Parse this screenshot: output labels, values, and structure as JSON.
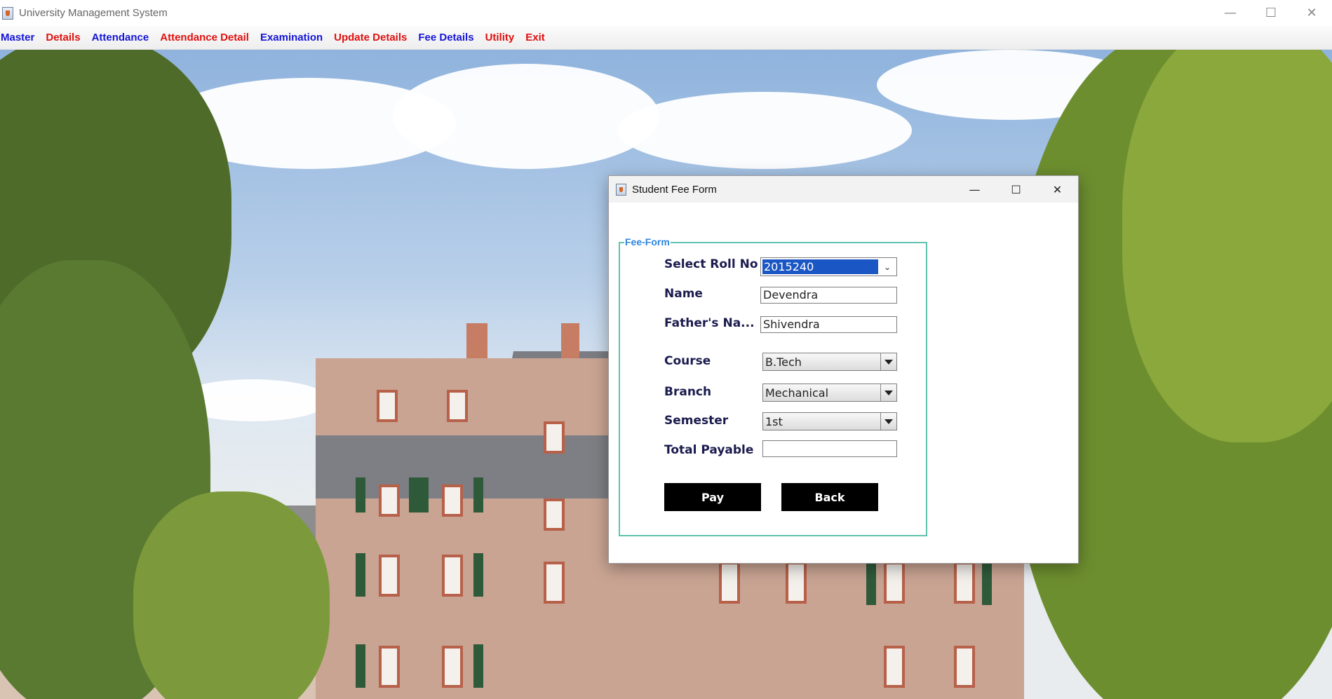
{
  "window": {
    "title": "University Management System",
    "controls": {
      "minimize": "—",
      "maximize": "☐",
      "close": "✕"
    }
  },
  "menu": [
    {
      "label": "Master",
      "color": "#1515d8"
    },
    {
      "label": "Details",
      "color": "#e01010"
    },
    {
      "label": "Attendance",
      "color": "#1515d8"
    },
    {
      "label": "Attendance Detail",
      "color": "#e01010"
    },
    {
      "label": "Examination",
      "color": "#1515d8"
    },
    {
      "label": "Update Details",
      "color": "#e01010"
    },
    {
      "label": "Fee Details",
      "color": "#1515d8"
    },
    {
      "label": "Utility",
      "color": "#e01010"
    },
    {
      "label": "Exit",
      "color": "#e01010"
    }
  ],
  "dialog": {
    "title": "Student Fee Form",
    "controls": {
      "minimize": "—",
      "maximize": "☐",
      "close": "✕"
    },
    "group_title": "Fee-Form",
    "fields": {
      "roll_no": {
        "label": "Select Roll No",
        "value": "2015240"
      },
      "name": {
        "label": "Name",
        "value": "Devendra"
      },
      "father_name": {
        "label": "Father's Na...",
        "value": "Shivendra"
      },
      "course": {
        "label": "Course",
        "value": "B.Tech"
      },
      "branch": {
        "label": "Branch",
        "value": "Mechanical"
      },
      "semester": {
        "label": "Semester",
        "value": "1st"
      },
      "total_payable": {
        "label": "Total Payable",
        "value": ""
      }
    },
    "buttons": {
      "pay": "Pay",
      "back": "Back"
    }
  }
}
